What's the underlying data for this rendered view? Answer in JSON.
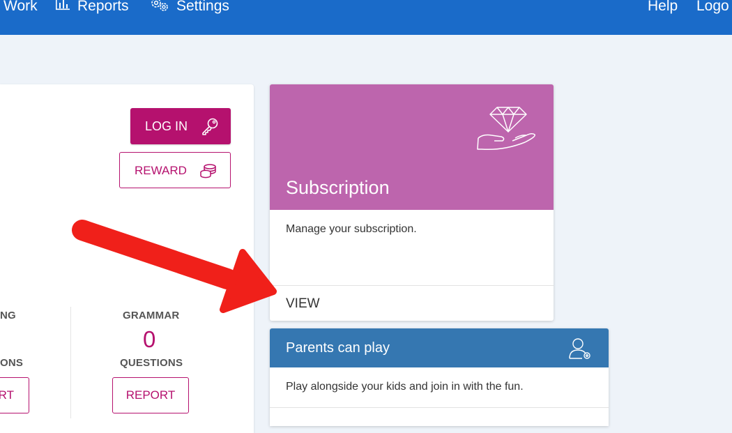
{
  "nav": {
    "work_label": "Work",
    "reports_label": "Reports",
    "settings_label": "Settings",
    "help_label": "Help",
    "logout_label": "Logo"
  },
  "left_card": {
    "login_label": "LOG IN",
    "reward_label": "REWARD",
    "col1": {
      "label_top": "NG",
      "label_bottom": "ONS",
      "button": "RT"
    },
    "col2": {
      "label_top": "GRAMMAR",
      "value": "0",
      "label_bottom": "QUESTIONS",
      "button": "REPORT"
    }
  },
  "subscription": {
    "title": "Subscription",
    "description": "Manage your subscription.",
    "view_label": "VIEW"
  },
  "parents": {
    "title": "Parents can play",
    "description": "Play alongside your kids and join in with the fun."
  },
  "colors": {
    "nav_bg": "#1a6bc9",
    "page_bg": "#eef3f9",
    "brand_magenta": "#b5116e",
    "subscription_header": "#bd65ad",
    "parents_header": "#3577b1",
    "annotation_arrow": "#f0201a"
  },
  "icons": [
    "bar-chart-icon",
    "gears-icon",
    "key-icon",
    "coins-icon",
    "diamond-hand-icon",
    "user-settings-icon",
    "red-arrow-annotation"
  ]
}
